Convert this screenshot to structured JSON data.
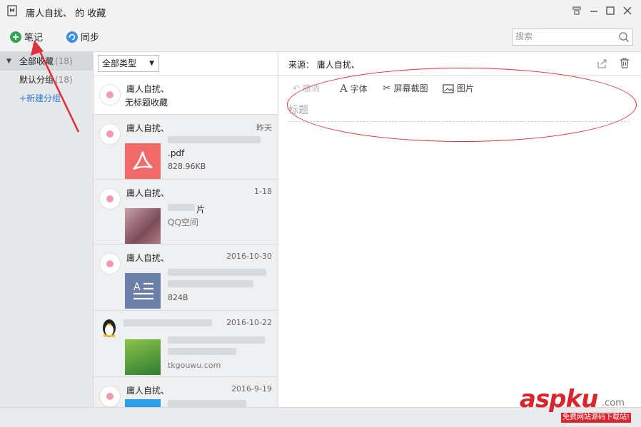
{
  "window": {
    "title": "庸人自扰、 的 收藏"
  },
  "toolbar": {
    "note_label": "笔记",
    "sync_label": "同步",
    "search_placeholder": "搜索"
  },
  "sidebar": {
    "all": {
      "label": "全部收藏",
      "count": "(18)"
    },
    "default": {
      "label": "默认分组",
      "count": "(18)"
    },
    "new_group": "+新建分组"
  },
  "list": {
    "filter": "全部类型",
    "items": [
      {
        "source": "庸人自扰、",
        "line": "无标题收藏",
        "date": ""
      },
      {
        "source": "庸人自扰、",
        "date": "昨天",
        "name": ".pdf",
        "size": "828.96KB"
      },
      {
        "source": "庸人自扰、",
        "date": "1-18",
        "name": "片",
        "sub": "QQ空间"
      },
      {
        "source": "庸人自扰、",
        "date": "2016-10-30",
        "size": "824B"
      },
      {
        "source": "",
        "date": "2016-10-22",
        "sub": "tkgouwu.com"
      },
      {
        "source": "庸人自扰、",
        "date": "2016-9-19"
      }
    ]
  },
  "detail": {
    "source": "来源：  庸人自扰、",
    "undo": "撤消",
    "font": "字体",
    "screenshot": "屏幕截图",
    "image": "图片",
    "title_placeholder": "标题"
  },
  "watermark": {
    "brand": "aspku",
    "suffix": ".com",
    "tagline": "免费网站源码下载站!"
  },
  "colors": {
    "accent": "#2f7fd8",
    "annotation": "#e0323a",
    "pdf": "#f16a6a",
    "doc": "#6b7fa8",
    "add": "#2ea84b"
  }
}
